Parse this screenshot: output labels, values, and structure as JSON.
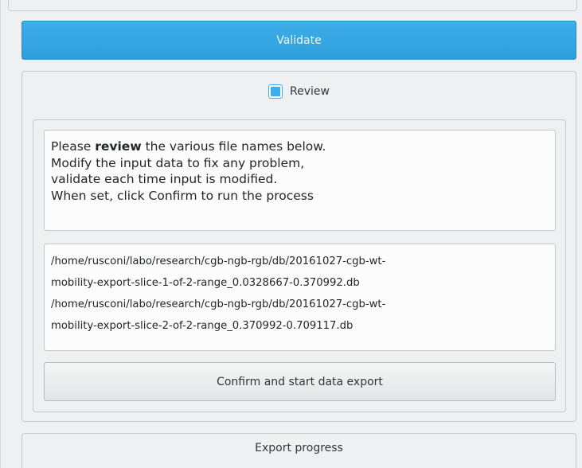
{
  "validate_button": {
    "label": "Validate"
  },
  "review": {
    "checkbox_label": "Review",
    "checked": true,
    "info_prefix": "Please ",
    "info_bold": "review",
    "info_line1_suffix": " the various file names below.",
    "info_line2": "Modify the input data to fix any problem,",
    "info_line3": "validate each time input is modified.",
    "info_line4": "When set, click Confirm to run the process",
    "files": [
      "/home/rusconi/labo/research/cgb-ngb-rgb/db/20161027-cgb-wt-",
      "mobility-export-slice-1-of-2-range_0.0328667-0.370992.db",
      "/home/rusconi/labo/research/cgb-ngb-rgb/db/20161027-cgb-wt-",
      "mobility-export-slice-2-of-2-range_0.370992-0.709117.db"
    ],
    "confirm_label": "Confirm and start data export"
  },
  "export_progress": {
    "title": "Export progress"
  },
  "colors": {
    "accent": "#3daee9",
    "background": "#eff0f1",
    "field_background": "#fcfcfc",
    "text": "#31363b"
  }
}
